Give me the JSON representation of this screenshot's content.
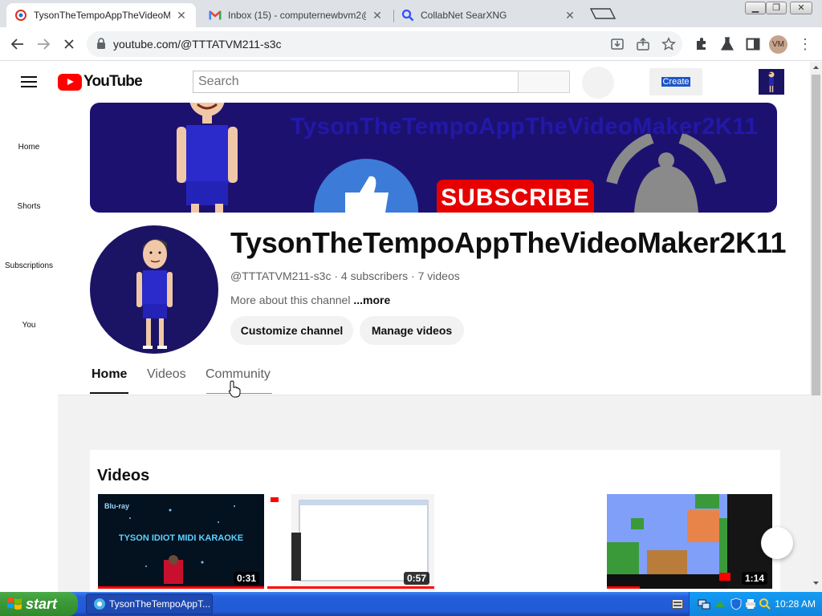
{
  "browser": {
    "tabs": [
      {
        "title": "TysonTheTempoAppTheVideoMaker...",
        "active": true
      },
      {
        "title": "Inbox (15) - computernewbvm2@g",
        "active": false
      },
      {
        "title": "CollabNet SearXNG",
        "active": false
      }
    ],
    "address": "youtube.com/@TTTATVM211-s3c",
    "profile_initials": "VM"
  },
  "youtube": {
    "logo_text": "YouTube",
    "search_placeholder": "Search",
    "create_label": "Create",
    "guide": [
      "Home",
      "Shorts",
      "Subscriptions",
      "You"
    ]
  },
  "channel": {
    "banner_text": "TysonTheTempoAppTheVideoMaker2K11",
    "banner_subscribe": "SUBSCRIBE",
    "name": "TysonTheTempoAppTheVideoMaker2K11",
    "meta": "@TTTATVM211-s3c · 4 subscribers · 7 videos",
    "about_prefix": "More about this channel",
    "about_more": " ...more",
    "customize_label": "Customize channel",
    "manage_label": "Manage videos",
    "tabs": [
      "Home",
      "Videos",
      "Community"
    ],
    "active_tab": "Home"
  },
  "videos_section": {
    "heading": "Videos",
    "items": [
      {
        "thumb_text": "TYSON IDIOT MIDI KARAOKE",
        "duration": "0:31",
        "progress": 1.0
      },
      {
        "duration": "0:57",
        "progress": 1.0
      },
      {
        "duration": "1:14",
        "progress": 0.2
      }
    ]
  },
  "taskbar": {
    "start_label": "start",
    "task_label": "TysonTheTempoAppT...",
    "clock": "10:28 AM"
  },
  "colors": {
    "youtube_red": "#ff0000",
    "banner": "#1d1170",
    "taskbar": "#245edb",
    "start_green": "#3c9a38"
  }
}
